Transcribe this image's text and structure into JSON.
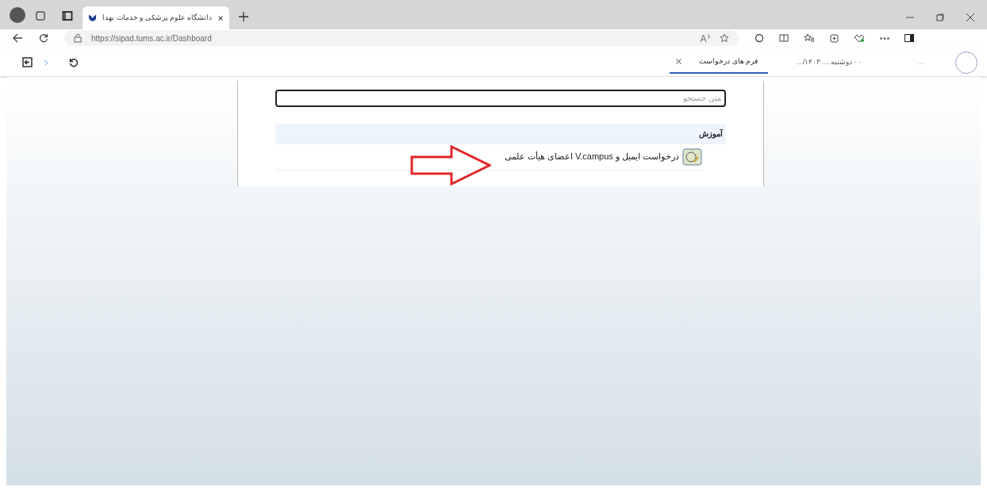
{
  "browser": {
    "tabs": [
      {
        "title": "دانشگاه علوم پزشکی و خدمات بهدا",
        "selected": true
      }
    ],
    "url": "https://sipad.tums.ac.ir/Dashboard"
  },
  "app": {
    "user_label": "...",
    "date": "۰۰ دوشنبه ... ۱۴۰۳/...",
    "tabs": [
      {
        "label": "فرم های درخواست",
        "selected": true
      }
    ]
  },
  "search": {
    "placeholder": "متن جستجو"
  },
  "sections": [
    {
      "title": "آموزش",
      "items": [
        {
          "label": "درخواست ایمیل و V.campus اعضای هیأت علمی"
        }
      ]
    }
  ]
}
